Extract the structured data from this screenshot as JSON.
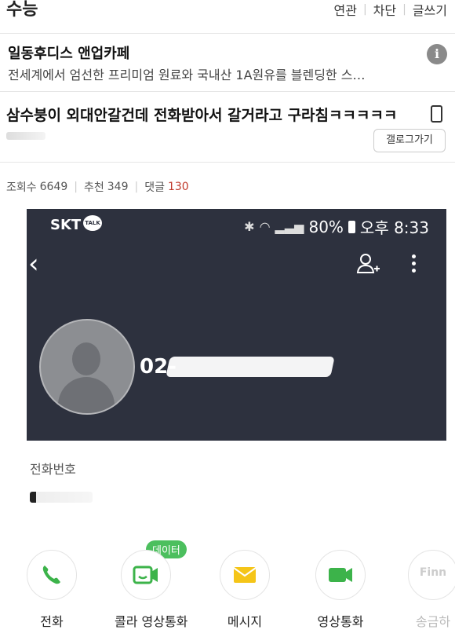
{
  "header": {
    "gallery_title": "수능",
    "links": [
      "연관",
      "차단",
      "글쓰기"
    ]
  },
  "ad": {
    "title": "일동후디스 앤업카페",
    "description": "전세계에서 엄선한 프리미엄 원료와 국내산 1A원유를 블렌딩한 스…",
    "info_icon": "i"
  },
  "post": {
    "title": "삼수붕이 외대안갈건데 전화받아서 갈거라고 구라침ㅋㅋㅋㅋㅋ",
    "gallery_button": "갤로그가기",
    "views_label": "조회수",
    "views": "6649",
    "recommend_label": "추천",
    "recommend": "349",
    "comments_label": "댓글",
    "comments": "130"
  },
  "screenshot": {
    "carrier": "SKT",
    "talk_badge": "TALK",
    "battery": "80%",
    "time": "오후 8:33",
    "phone_number": "02-",
    "bg_color": "#2d313e"
  },
  "contact": {
    "phone_label": "전화번호"
  },
  "actions": {
    "data_badge": "데이터",
    "items": [
      {
        "label": "전화",
        "icon": "phone-icon"
      },
      {
        "label": "콜라 영상통화",
        "icon": "video-call-icon"
      },
      {
        "label": "메시지",
        "icon": "message-icon"
      },
      {
        "label": "영상통화",
        "icon": "video-icon"
      },
      {
        "label": "송금하",
        "icon": "finn-icon",
        "icon_text": "Finn"
      }
    ]
  }
}
